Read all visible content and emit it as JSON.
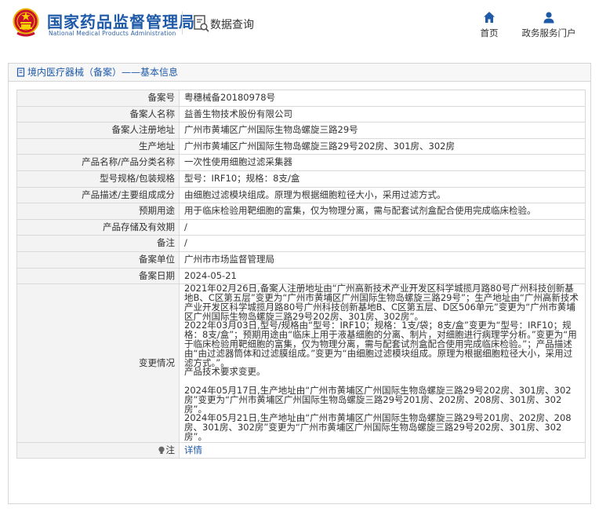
{
  "header": {
    "site_name_cn": "国家药品监督管理局",
    "site_name_en": "National Medical Products Administration",
    "section_title": "数据查询",
    "nav": [
      {
        "label": "首页",
        "icon": "home-icon"
      },
      {
        "label": "政务服务门户",
        "icon": "user-icon"
      }
    ]
  },
  "panel": {
    "title": "境内医疗器械（备案）——基本信息"
  },
  "record": {
    "fields": [
      {
        "label": "备案号",
        "value": "粤穗械备20180978号"
      },
      {
        "label": "备案人名称",
        "value": "益善生物技术股份有限公司"
      },
      {
        "label": "备案人注册地址",
        "value": "广州市黄埔区广州国际生物岛螺旋三路29号"
      },
      {
        "label": "生产地址",
        "value": "广州市黄埔区广州国际生物岛螺旋三路29号202房、301房、302房"
      },
      {
        "label": "产品名称/产品分类名称",
        "value": "一次性使用细胞过滤采集器"
      },
      {
        "label": "型号规格/包装规格",
        "value": "型号：IRF10；规格：8支/盒"
      },
      {
        "label": "产品描述/主要组成成分",
        "value": "由细胞过滤模块组成。原理为根据细胞粒径大小，采用过滤方式。"
      },
      {
        "label": "预期用途",
        "value": "用于临床检验用靶细胞的富集，仅为物理分离，需与配套试剂盒配合使用完成临床检验。"
      },
      {
        "label": "产品存储及有效期",
        "value": "/"
      },
      {
        "label": "备注",
        "value": "/"
      },
      {
        "label": "备案单位",
        "value": "广州市市场监督管理局"
      },
      {
        "label": "备案日期",
        "value": "2024-05-21"
      }
    ],
    "change": {
      "label": "变更情况",
      "p1": "2021年02月26日,备案人注册地址由“广州高新技术产业开发区科学城揽月路80号广州科技创新基地B、C区第五层”变更为“广州市黄埔区广州国际生物岛螺旋三路29号”；生产地址由“广州高新技术产业开发区科学城揽月路80号广州科技创新基地B、C区第五层、D区506单元”变更为“广州市黄埔区广州国际生物岛螺旋三路29号202房、301房、302房”。",
      "p2": "2022年03月03日,型号/规格由“型号：IRF10；规格：1支/袋；8支/盒”变更为“型号：IRF10；规格：8支/盒”；预期用途由“临床上用于液基细胞的分离、制片，对细胞进行病理学分析。”变更为“用于临床检验用靶细胞的富集，仅为物理分离，需与配套试剂盒配合使用完成临床检验。”；产品描述由“由过滤器筒体和过滤膜组成。”变更为“由细胞过滤模块组成。原理为根据细胞粒径大小，采用过滤方式。”。",
      "p3": "产品技术要求变更。",
      "p4": "2024年05月17日,生产地址由“广州市黄埔区广州国际生物岛螺旋三路29号202房、301房、302房”变更为“广州市黄埔区广州国际生物岛螺旋三路29号201房、202房、208房、301房、302房”。",
      "p5": "2024年05月21日,生产地址由“广州市黄埔区广州国际生物岛螺旋三路29号201房、202房、208房、301房、302房”变更为“广州市黄埔区广州国际生物岛螺旋三路29号202房、301房、302房”。"
    },
    "note": {
      "label": "注",
      "link": "详情"
    }
  }
}
